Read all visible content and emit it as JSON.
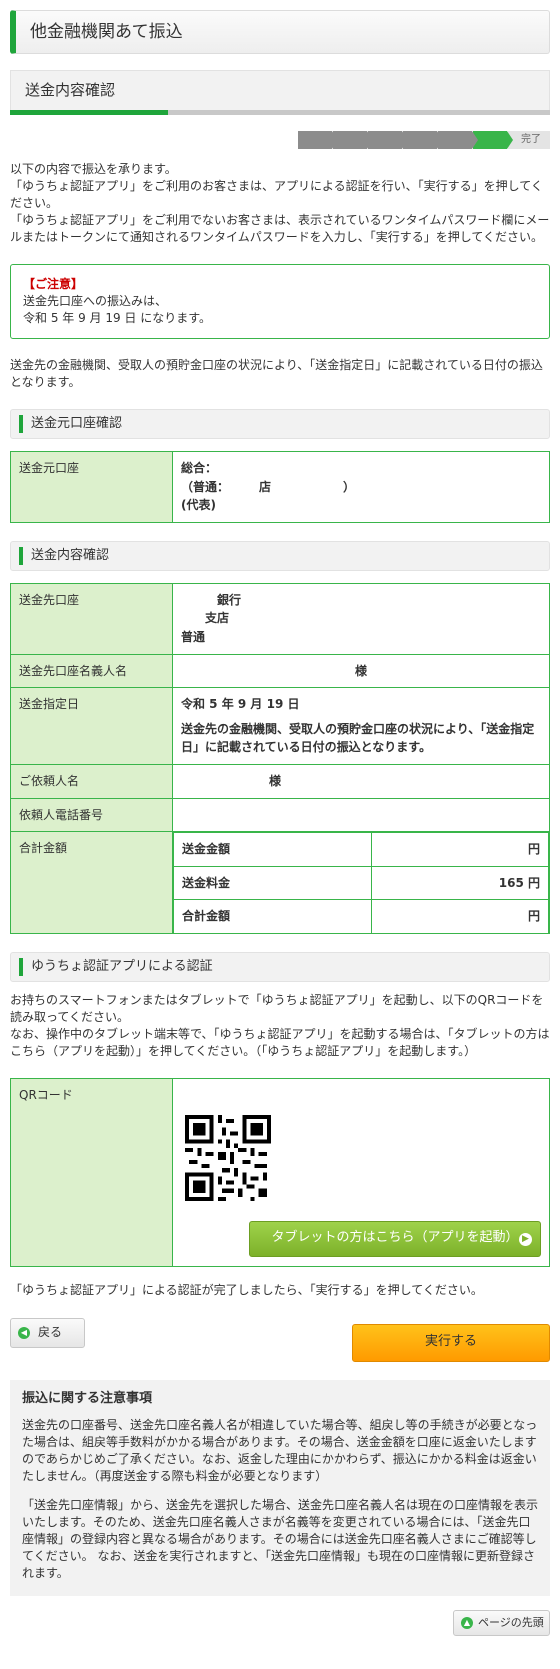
{
  "page_title": "他金融機関あて振込",
  "sub_title": "送金内容確認",
  "steps": {
    "done_label": "完了"
  },
  "intro": [
    "以下の内容で振込を承ります。",
    "「ゆうちょ認証アプリ」をご利用のお客さまは、アプリによる認証を行い、「実行する」を押してください。",
    "「ゆうちょ認証アプリ」をご利用でないお客さまは、表示されているワンタイムパスワード欄にメールまたはトークンにて通知されるワンタイムパスワードを入力し、「実行する」を押してください。"
  ],
  "notice": {
    "title": "【ご注意】",
    "line1": "送金先口座への振込みは、",
    "line2": "令和 5 年 9 月 19 日 になります。"
  },
  "schedule_note": "送金先の金融機関、受取人の預貯金口座の状況により、「送金指定日」に記載されている日付の振込となります。",
  "source_section": {
    "heading": "送金元口座確認",
    "label": "送金元口座",
    "line1": "総合：",
    "line2": "（普通：　　　店　　　　　　）",
    "line3": "(代表)"
  },
  "detail_section": {
    "heading": "送金内容確認",
    "dest_label": "送金先口座",
    "dest_bank": "銀行",
    "dest_branch": "支店",
    "dest_type": "普通",
    "holder_label": "送金先口座名義人名",
    "holder_value": "様",
    "date_label": "送金指定日",
    "date_value": "令和 5 年 9 月 19 日",
    "date_note": "送金先の金融機関、受取人の預貯金口座の状況により、「送金指定日」に記載されている日付の振込となります。",
    "requester_label": "ご依頼人名",
    "requester_value": "様",
    "phone_label": "依頼人電話番号",
    "phone_value": "",
    "total_label": "合計金額",
    "amount_label": "送金金額",
    "amount_value": "円",
    "fee_label": "送金料金",
    "fee_value": "165 円",
    "sum_label": "合計金額",
    "sum_value": "円"
  },
  "auth_section": {
    "heading": "ゆうちょ認証アプリによる認証",
    "text1": "お持ちのスマートフォンまたはタブレットで「ゆうちょ認証アプリ」を起動し、以下のQRコードを読み取ってください。",
    "text2": "なお、操作中のタブレット端末等で、「ゆうちょ認証アプリ」を起動する場合は、「タブレットの方はこちら（アプリを起動）」を押してください。（「ゆうちょ認証アプリ」を起動します。）",
    "qr_label": "QRコード",
    "app_button": "タブレットの方はこちら（アプリを起動）"
  },
  "after_qr": "「ゆうちょ認証アプリ」による認証が完了しましたら、「実行する」を押してください。",
  "buttons": {
    "back": "戻る",
    "execute": "実行する",
    "page_top": "ページの先頭"
  },
  "caution": {
    "title": "振込に関する注意事項",
    "p1": "送金先の口座番号、送金先口座名義人名が相違していた場合等、組戻し等の手続きが必要となった場合は、組戻等手数料がかかる場合があります。その場合、送金金額を口座に返金いたしますのであらかじめご了承ください。なお、返金した理由にかかわらず、振込にかかる料金は返金いたしません。（再度送金する際も料金が必要となります）",
    "p2": "「送金先口座情報」から、送金先を選択した場合、送金先口座名義人名は現在の口座情報を表示いたします。そのため、送金先口座名義人さまが名義等を変更されている場合には、「送金先口座情報」の登録内容と異なる場合があります。その場合には送金先口座名義人さまにご確認等してください。 なお、送金を実行されますと、「送金先口座情報」も現在の口座情報に更新登録されます。"
  },
  "colors": {
    "accent": "#1fa53b",
    "table_header": "#dcf0cc",
    "execute": "#ff9a00",
    "app_button": "#7db12a"
  }
}
